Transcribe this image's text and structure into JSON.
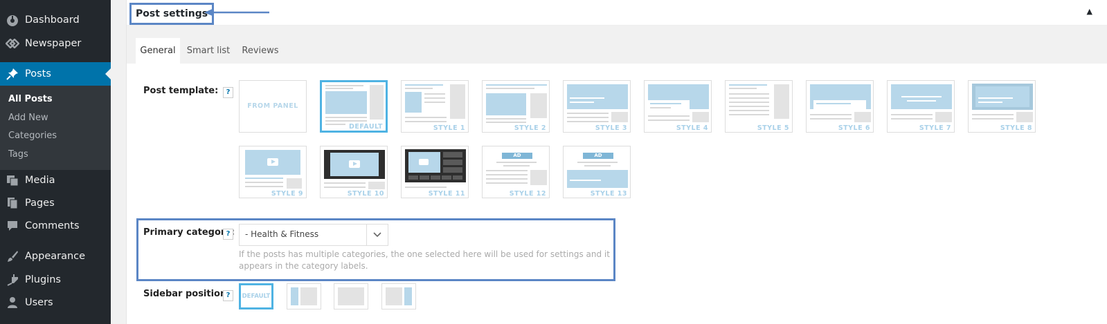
{
  "admin_menu": {
    "items": [
      {
        "label": "Dashboard",
        "icon": "dashboard-icon"
      },
      {
        "label": "Newspaper",
        "icon": "newspaper-icon"
      },
      {
        "label": "Posts",
        "icon": "pin-icon",
        "active": true
      },
      {
        "label": "Media",
        "icon": "media-icon"
      },
      {
        "label": "Pages",
        "icon": "pages-icon"
      },
      {
        "label": "Comments",
        "icon": "comment-icon"
      },
      {
        "label": "Appearance",
        "icon": "brush-icon"
      },
      {
        "label": "Plugins",
        "icon": "plugin-icon"
      },
      {
        "label": "Users",
        "icon": "user-icon"
      }
    ],
    "posts_submenu": [
      "All Posts",
      "Add New",
      "Categories",
      "Tags"
    ],
    "current_submenu": "All Posts"
  },
  "postbox": {
    "title": "Post settings",
    "toggle_icon": "▲",
    "tabs": [
      "General",
      "Smart list",
      "Reviews"
    ],
    "active_tab": "General"
  },
  "post_template": {
    "label": "Post template:",
    "help": "?",
    "from_panel_label": "FROM PANEL",
    "styles": [
      "DEFAULT",
      "STYLE 1",
      "STYLE 2",
      "STYLE 3",
      "STYLE 4",
      "STYLE 5",
      "STYLE 6",
      "STYLE 7",
      "STYLE 8",
      "STYLE 9",
      "STYLE 10",
      "STYLE 11",
      "STYLE 12",
      "STYLE 13"
    ],
    "selected": "DEFAULT",
    "ad_label": "AD"
  },
  "primary_category": {
    "label": "Primary category:",
    "help": "?",
    "value": "- Health & Fitness",
    "description": "If the posts has multiple categories, the one selected here will be used for settings and it appears in the category labels."
  },
  "sidebar_position": {
    "label": "Sidebar position:",
    "help": "?",
    "default_label": "DEFAULT"
  },
  "colors": {
    "admin_bg": "#23282d",
    "admin_active": "#0073aa",
    "selected_border": "#4fb3e3",
    "annotation": "#5b86c5"
  }
}
